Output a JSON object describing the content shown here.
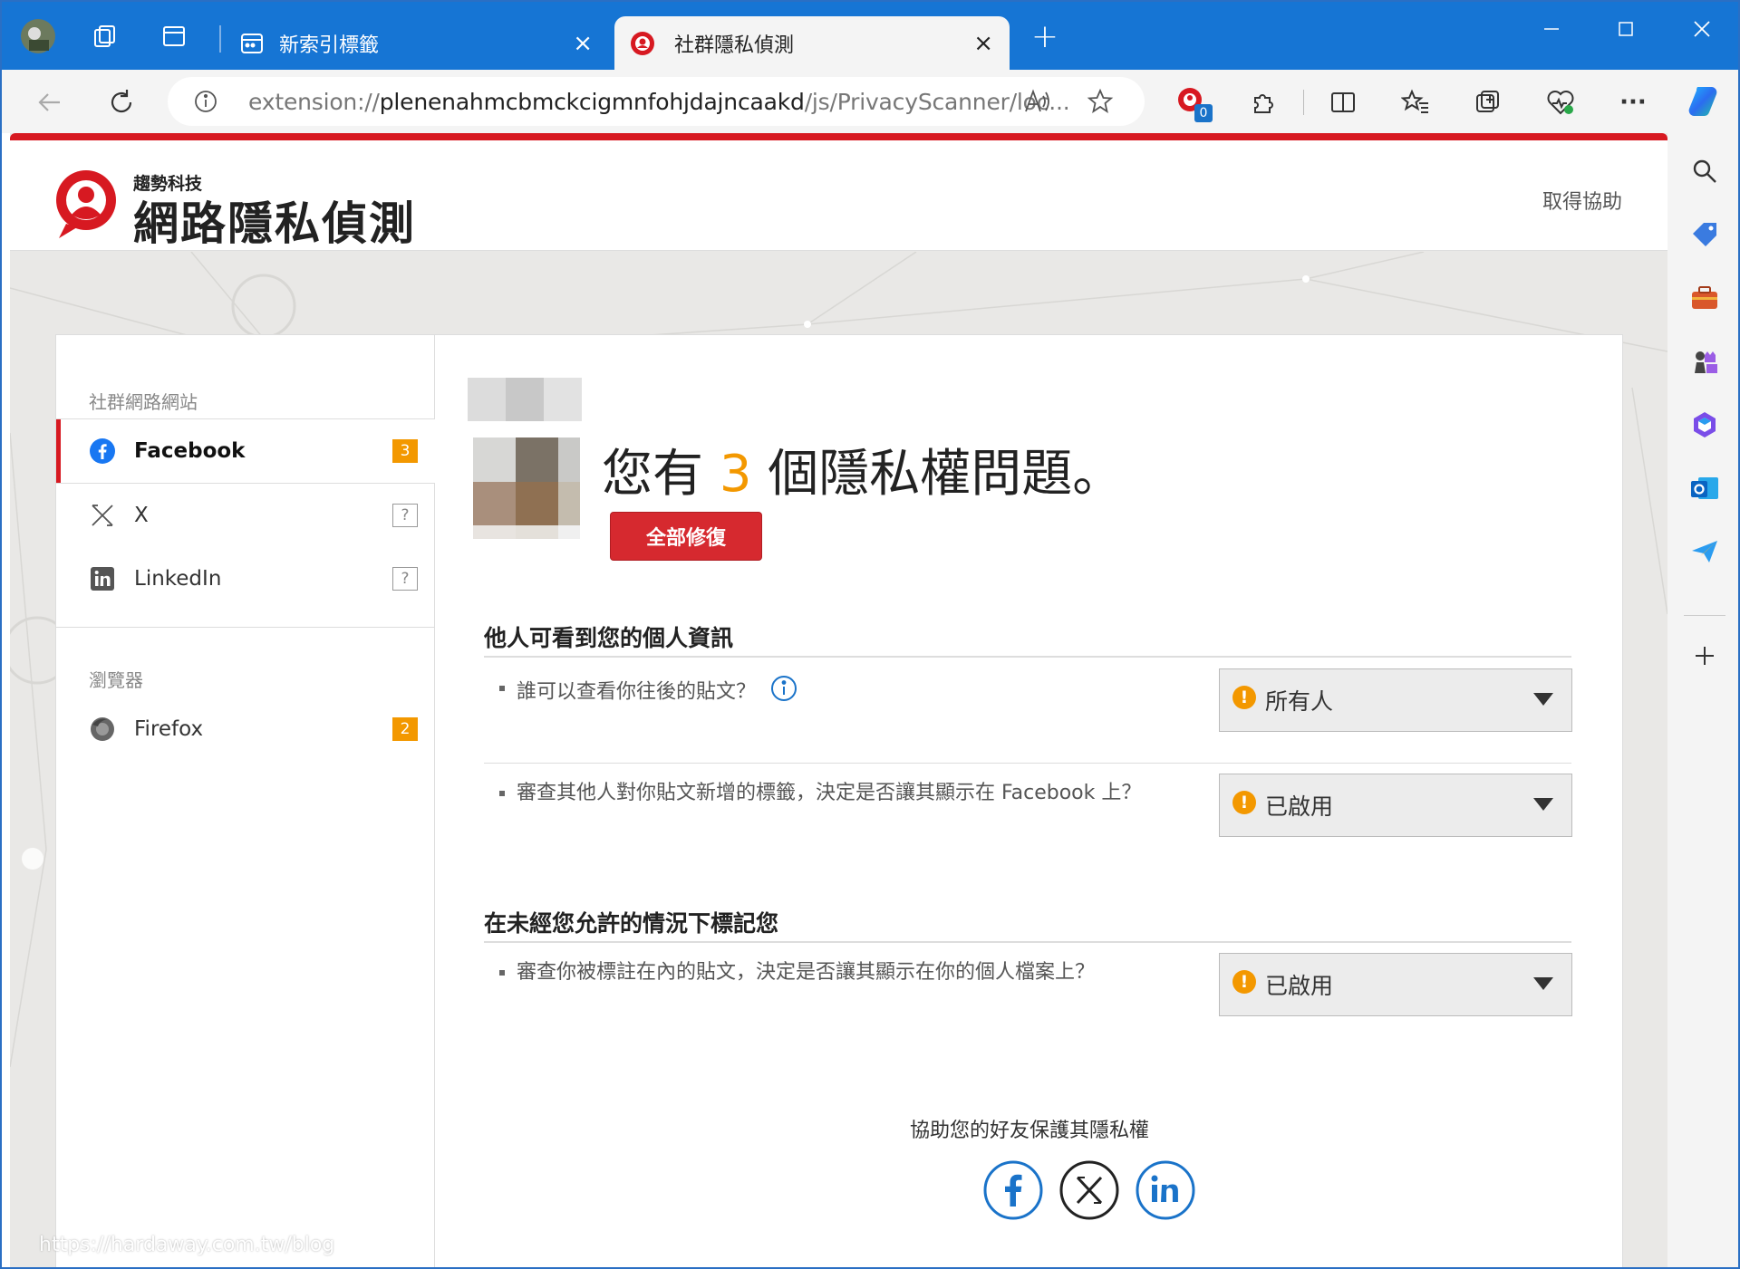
{
  "browser": {
    "tabs": [
      {
        "label": "新索引標籤",
        "active": false
      },
      {
        "label": "社群隱私偵測",
        "active": true
      }
    ],
    "url_prefix": "extension://",
    "url_host": "plenenahmcbmckcigmnfohjdajncaakd",
    "url_path": "/js/PrivacyScanner/loc...",
    "extension_badge": "0",
    "new_tab_symbol": "+",
    "close_symbol": "×",
    "more_symbol": "···"
  },
  "header": {
    "brand_small": "趨勢科技",
    "brand_big": "網路隱私偵測",
    "help_link": "取得協助"
  },
  "sidebar": {
    "social_title": "社群網路網站",
    "social_items": [
      {
        "label": "Facebook",
        "badge": "3",
        "icon": "facebook-icon",
        "active": true
      },
      {
        "label": "X",
        "badge": "?",
        "icon": "x-icon",
        "active": false
      },
      {
        "label": "LinkedIn",
        "badge": "?",
        "icon": "linkedin-icon",
        "active": false
      }
    ],
    "browser_title": "瀏覽器",
    "browser_items": [
      {
        "label": "Firefox",
        "badge": "2",
        "icon": "firefox-icon"
      }
    ]
  },
  "main": {
    "title_prefix": "您有",
    "issue_count": "3",
    "title_suffix": "個隱私權問題。",
    "fix_all": "全部修復",
    "sections": [
      {
        "heading": "他人可看到您的個人資訊",
        "questions": [
          {
            "text": "誰可以查看你往後的貼文？",
            "value": "所有人"
          },
          {
            "text": "審查其他人對你貼文新增的標籤，決定是否讓其顯示在 Facebook 上？",
            "value": "已啟用"
          }
        ]
      },
      {
        "heading": "在未經您允許的情況下標記您",
        "questions": [
          {
            "text": "審查你被標註在內的貼文，決定是否讓其顯示在你的個人檔案上？",
            "value": "已啟用"
          }
        ]
      }
    ],
    "share_title": "協助您的好友保護其隱私權"
  },
  "watermark": "https://hardaway.com.tw/blog",
  "colors": {
    "accent": "#d71921",
    "warning": "#f39800",
    "titlebar": "#1675d4",
    "share": "#1a73c9"
  }
}
